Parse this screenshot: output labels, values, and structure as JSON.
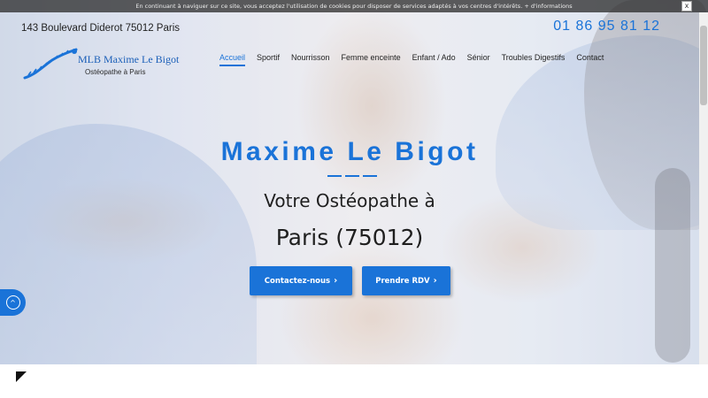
{
  "cookie_bar": {
    "text": "En continuant à naviguer sur ce site, vous acceptez l'utilisation de cookies pour disposer de services adaptés à vos centres d'intérêts. + d'informations",
    "close_label": "x"
  },
  "header": {
    "address": "143 Boulevard Diderot 75012 Paris",
    "phone": "01 86 95 81 12"
  },
  "logo": {
    "name": "MLB Maxime Le Bigot",
    "subtitle": "Ostéopathe à Paris"
  },
  "nav": {
    "items": [
      {
        "label": "Accueil",
        "active": true
      },
      {
        "label": "Sportif",
        "active": false
      },
      {
        "label": "Nourrisson",
        "active": false
      },
      {
        "label": "Femme enceinte",
        "active": false
      },
      {
        "label": "Enfant / Ado",
        "active": false
      },
      {
        "label": "Sénior",
        "active": false
      },
      {
        "label": "Troubles Digestifs",
        "active": false
      },
      {
        "label": "Contact",
        "active": false
      }
    ]
  },
  "hero": {
    "title": "Maxime Le Bigot",
    "subtitle": "Votre Ostéopathe à",
    "city": "Paris (75012)",
    "buttons": {
      "contact": "Contactez-nous",
      "rdv": "Prendre RDV"
    }
  },
  "colors": {
    "accent": "#1a73d8",
    "text": "#1f1f1f"
  },
  "icons": {
    "button_chevron": "›",
    "scroll_up": "^"
  }
}
